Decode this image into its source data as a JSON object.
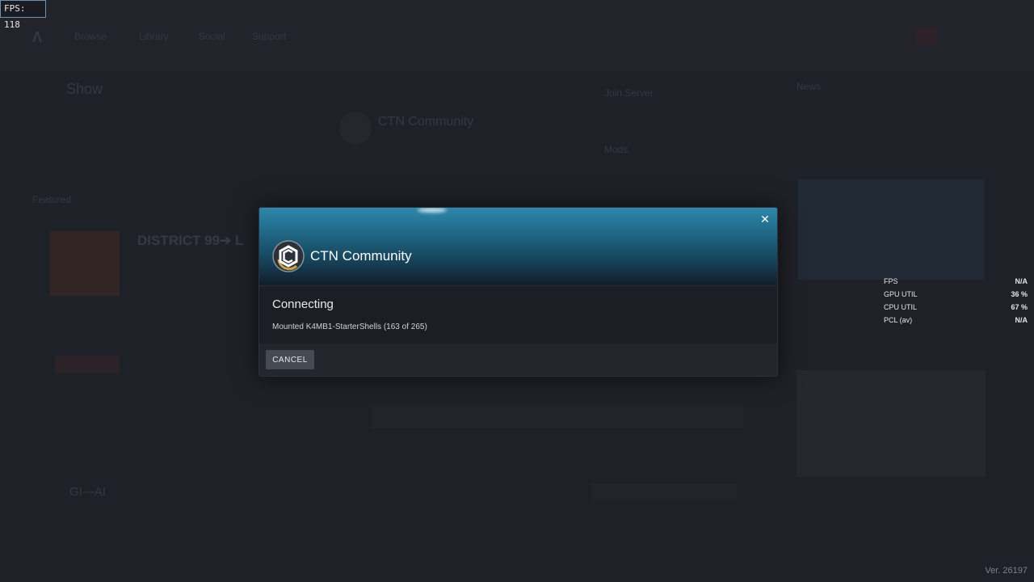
{
  "overlay": {
    "fps_counter": "FPS: 118",
    "version": "Ver. 26197"
  },
  "background": {
    "nav": [
      "Browse",
      "Library",
      "Social",
      "Support"
    ],
    "section_title": "Show",
    "server_card_title": "CTN Community",
    "featured_label": "Featured",
    "featured_title": "DISTRICT 99➔ L",
    "news_label": "News",
    "bottom_label": "GI—AI",
    "news_items": [
      "Join Server",
      "Mods"
    ]
  },
  "modal": {
    "server_name": "CTN Community",
    "status_title": "Connecting",
    "status_detail": "Mounted K4MB1-StarterShells (163 of 265)",
    "cancel_label": "CANCEL",
    "close_icon": "✕",
    "logo_icon": "ctn-logo"
  },
  "perf_overlay": [
    {
      "label": "FPS",
      "value": "N/A"
    },
    {
      "label": "GPU UTIL",
      "value": "36 %"
    },
    {
      "label": "CPU UTIL",
      "value": "67 %"
    },
    {
      "label": "PCL (av)",
      "value": "N/A"
    }
  ],
  "colors": {
    "accent": "#2e87ab",
    "background": "#23252c",
    "modal": "#1b1d24"
  }
}
